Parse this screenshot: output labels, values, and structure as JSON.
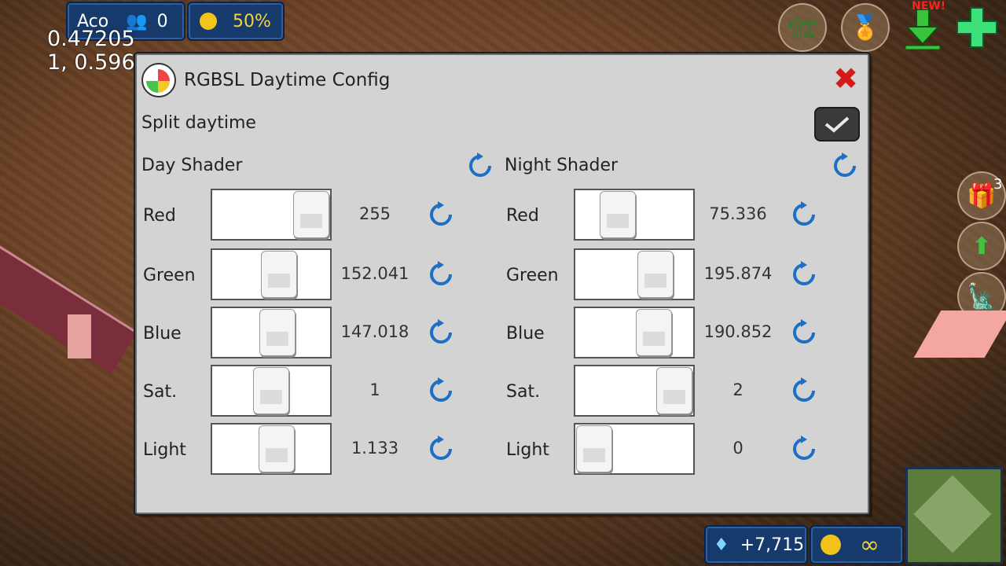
{
  "hud": {
    "player_name": "Aco",
    "population": "0",
    "happiness": "50%",
    "coords_line1": "0.47205",
    "coords_line2": "1, 0.596",
    "diamonds": "+7,715",
    "coins": "∞",
    "new_badge": "NEW!",
    "gift_count": "3"
  },
  "dialog": {
    "title": "RGBSL Daytime Config",
    "split_label": "Split daytime",
    "split_checked": true,
    "day": {
      "title": "Day Shader",
      "rows": [
        {
          "label": "Red",
          "value": "255",
          "level": 1.0
        },
        {
          "label": "Green",
          "value": "152.041",
          "level": 0.596
        },
        {
          "label": "Blue",
          "value": "147.018",
          "level": 0.577
        },
        {
          "label": "Sat.",
          "value": "1",
          "level": 0.5
        },
        {
          "label": "Light",
          "value": "1.133",
          "level": 0.566
        }
      ]
    },
    "night": {
      "title": "Night Shader",
      "rows": [
        {
          "label": "Red",
          "value": "75.336",
          "level": 0.295
        },
        {
          "label": "Green",
          "value": "195.874",
          "level": 0.768
        },
        {
          "label": "Blue",
          "value": "190.852",
          "level": 0.748
        },
        {
          "label": "Sat.",
          "value": "2",
          "level": 1.0
        },
        {
          "label": "Light",
          "value": "0",
          "level": 0.0
        }
      ]
    }
  },
  "colors": {
    "hud_blue": "#153a6b",
    "close_red": "#d41a1a",
    "reset_blue": "#1c6fc4"
  }
}
